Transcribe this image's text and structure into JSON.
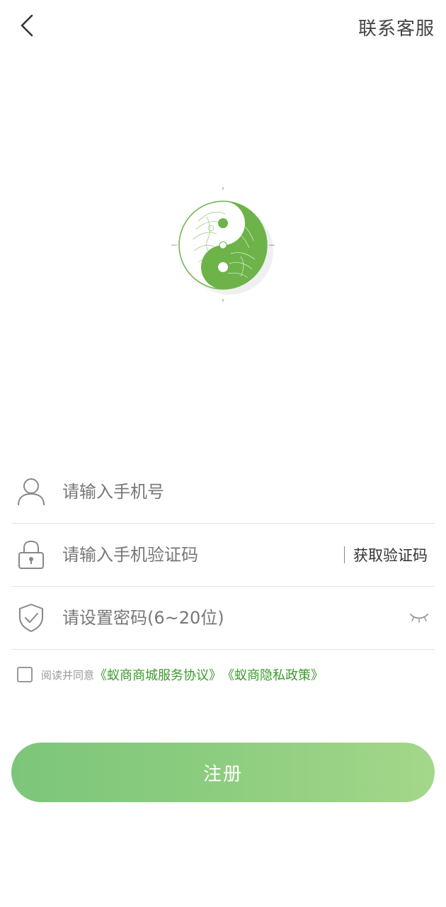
{
  "header": {
    "contact_label": "联系客服"
  },
  "form": {
    "phone_placeholder": "请输入手机号",
    "code_placeholder": "请输入手机验证码",
    "get_code_label": "获取验证码",
    "password_placeholder": "请设置密码(6~20位)"
  },
  "agreement": {
    "prefix": "阅读并同意",
    "service_link": "《蚁商商城服务协议》",
    "privacy_link": "《蚁商隐私政策》"
  },
  "register_label": "注册",
  "colors": {
    "accent_green": "#3a9a2a",
    "button_gradient_start": "#7cc67a",
    "button_gradient_end": "#a4d78a",
    "logo_green": "#6db34a"
  },
  "icons": {
    "back": "chevron-left-icon",
    "phone": "user-icon",
    "code": "lock-icon",
    "password": "shield-check-icon",
    "visibility": "eye-closed-icon"
  }
}
